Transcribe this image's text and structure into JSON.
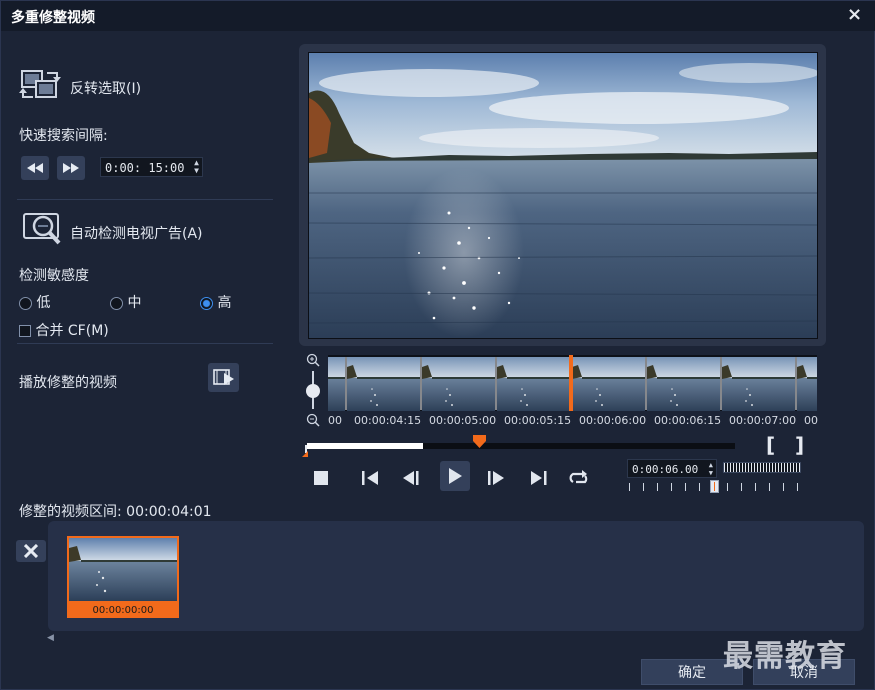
{
  "window": {
    "title": "多重修整视频",
    "close_glyph": "×"
  },
  "left": {
    "reverse_select_label": "反转选取(I)",
    "quick_search_label": "快速搜索间隔:",
    "interval_time": "0:00: 15:00",
    "auto_detect_label": "自动检测电视广告(A)",
    "sensitivity_label": "检测敏感度",
    "sensitivity_options": [
      "低",
      "中",
      "高"
    ],
    "sensitivity_selected": "高",
    "merge_cf_label": "合并 CF(M)",
    "play_trimmed_label": "播放修整的视频"
  },
  "timeline": {
    "timecodes": [
      "00",
      "00:00:04:15",
      "00:00:05:00",
      "00:00:05:15",
      "00:00:06:00",
      "00:00:06:15",
      "00:00:07:00",
      "00"
    ],
    "current_time": "0:00:06.00",
    "mark_in": "[",
    "mark_out": "]"
  },
  "trim": {
    "duration_label": "修整的视频区间: 00:00:04:01",
    "clips": [
      {
        "start": "00:00:00:00"
      }
    ]
  },
  "buttons": {
    "ok": "确定",
    "cancel": "取消"
  },
  "watermark": "最需教育",
  "colors": {
    "accent_orange": "#f26a1b",
    "radio_blue": "#3d8ff0",
    "panel_bg": "#1c2436"
  },
  "icons": [
    "reverse-select-icon",
    "rewind-icon",
    "fast-forward-icon",
    "tv-ad-detect-icon",
    "play-trimmed-icon",
    "zoom-in-icon",
    "zoom-out-icon",
    "stop-icon",
    "skip-start-icon",
    "step-back-icon",
    "play-icon",
    "step-forward-icon",
    "skip-end-icon",
    "loop-icon",
    "delete-clip-icon"
  ]
}
